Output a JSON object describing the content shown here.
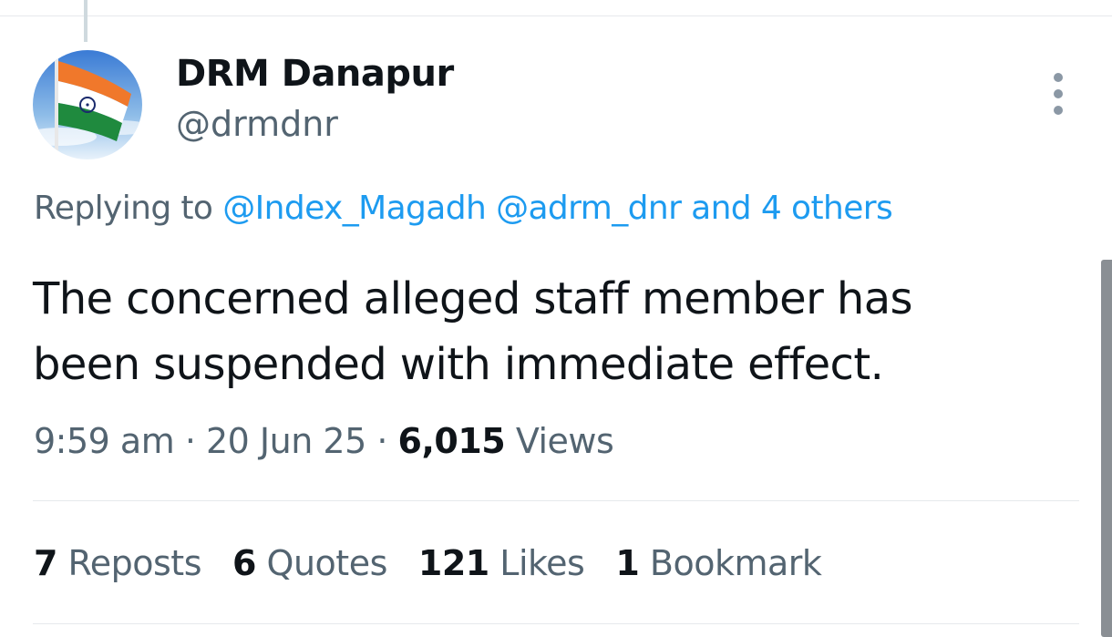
{
  "tweet": {
    "author": {
      "display_name": "DRM Danapur",
      "handle": "@drmdnr",
      "avatar_icon": "indian-flag-avatar"
    },
    "reply_context": {
      "prefix": "Replying to",
      "mentions": [
        "@Index_Magadh",
        "@adrm_dnr"
      ],
      "others": "and 4 others"
    },
    "text_lines": [
      "The concerned alleged staff member has",
      "been suspended with immediate effect."
    ],
    "meta": {
      "time": "9:59 am",
      "separator": "·",
      "date": "20 Jun 25",
      "views_count": "6,015",
      "views_label": "Views"
    },
    "stats": {
      "reposts": {
        "count": "7",
        "label": "Reposts"
      },
      "quotes": {
        "count": "6",
        "label": "Quotes"
      },
      "likes": {
        "count": "121",
        "label": "Likes"
      },
      "bookmarks": {
        "count": "1",
        "label": "Bookmark"
      }
    }
  },
  "icons": {
    "more": "more-vertical-icon"
  },
  "colors": {
    "link": "#1d9bf0",
    "secondary_text": "#536471",
    "primary_text": "#0f1419",
    "divider": "#e6e9ec"
  }
}
